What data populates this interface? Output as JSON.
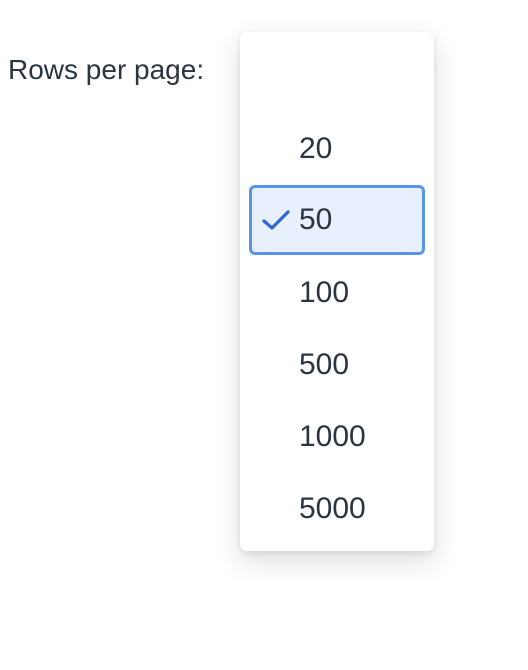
{
  "label": "Rows per page:",
  "dropdown": {
    "options": [
      {
        "label": "20",
        "selected": false
      },
      {
        "label": "50",
        "selected": true
      },
      {
        "label": "100",
        "selected": false
      },
      {
        "label": "500",
        "selected": false
      },
      {
        "label": "1000",
        "selected": false
      },
      {
        "label": "5000",
        "selected": false
      }
    ],
    "selected_icon": "check-icon"
  },
  "colors": {
    "text": "#2b3443",
    "selected_background": "#e7f0fc",
    "selected_border": "#5b93e6",
    "check": "#2f67d8"
  }
}
